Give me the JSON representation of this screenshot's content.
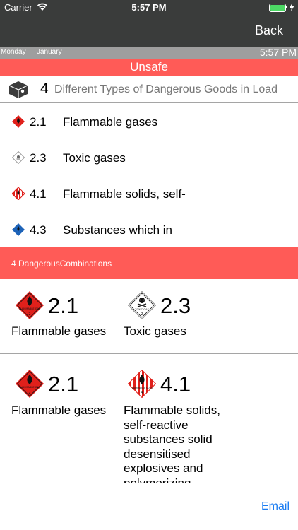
{
  "status": {
    "carrier": "Carrier",
    "time": "5:57 PM"
  },
  "nav": {
    "back_label": "Back"
  },
  "subbar": {
    "day": "Monday",
    "month": "January",
    "time": "5:57 PM"
  },
  "banner": {
    "label": "Unsafe"
  },
  "summary": {
    "count": "4",
    "text": "Different Types of Dangerous Goods in Load"
  },
  "classes": [
    {
      "code": "2.1",
      "name": "Flammable gases",
      "icon": "flammable-gas-diamond-icon"
    },
    {
      "code": "2.3",
      "name": "Toxic gases",
      "icon": "toxic-gas-diamond-icon"
    },
    {
      "code": "4.1",
      "name": "Flammable solids, self-",
      "icon": "flammable-solid-diamond-icon"
    },
    {
      "code": "4.3",
      "name": "Substances which in",
      "icon": "dangerous-when-wet-diamond-icon"
    }
  ],
  "combinations_header": {
    "label": "4 DangerousCombinations"
  },
  "combinations": [
    {
      "left": {
        "code": "2.1",
        "name": "Flammable gases"
      },
      "right": {
        "code": "2.3",
        "name": "Toxic gases"
      }
    },
    {
      "left": {
        "code": "2.1",
        "name": "Flammable gases"
      },
      "right": {
        "code": "4.1",
        "name": "Flammable solids, self-reactive substances solid desensitised explosives and polymerizing"
      }
    }
  ],
  "placard_text": {
    "flammable_gas": "FLAMMABLE GAS",
    "toxic_gas": "TOXIC GAS",
    "flammable_solid": "FLAMMABLE SOLID",
    "class_2": "2",
    "class_4": "4"
  },
  "footer": {
    "email_label": "Email"
  },
  "colors": {
    "nav_bg": "#3a3c3b",
    "alert_red": "#ff5b57",
    "link_blue": "#1a7cf2"
  }
}
